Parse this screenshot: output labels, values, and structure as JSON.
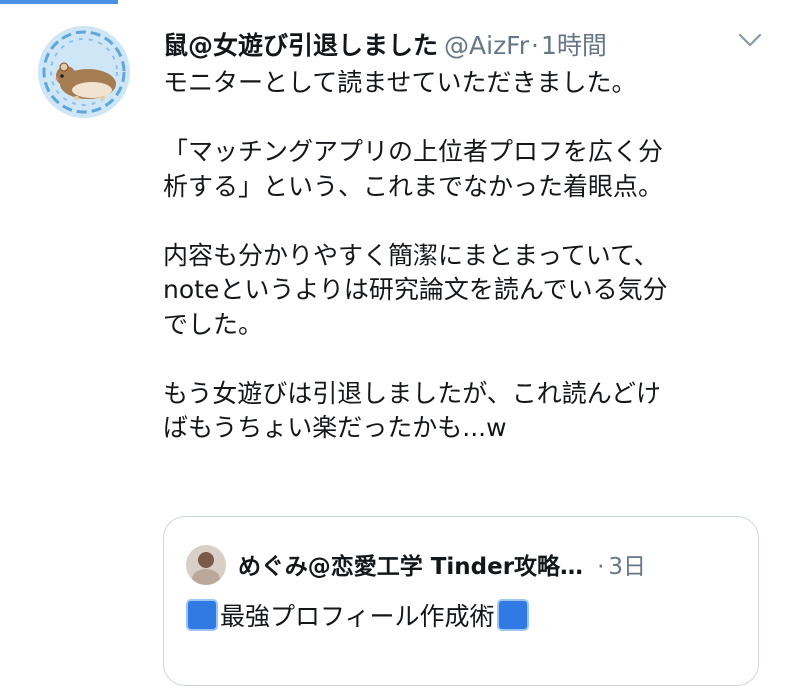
{
  "tweet": {
    "display_name": "鼠@女遊び引退しました",
    "handle": "@AizFr",
    "separator": "·",
    "time": "1時間",
    "paragraphs": [
      [
        "モニターとして読ませていただきました。"
      ],
      [
        "「マッチングアプリの上位者プロフを広く分",
        "析する」という、これまでなかった着眼点。"
      ],
      [
        "内容も分かりやすく簡潔にまとまっていて、",
        "noteというよりは研究論文を読んでいる気分",
        "でした。"
      ],
      [
        "もう女遊びは引退しましたが、これ読んどけ",
        "ばもうちょい楽だったかも...w"
      ]
    ]
  },
  "quote": {
    "display_name": "めぐみ@恋愛工学 Tinder攻略…",
    "separator": "·",
    "time": "3日",
    "text": "最強プロフィール作成術",
    "emoji_icon": "blue-square-emoji",
    "emoji_color": "#2f7be3"
  },
  "colors": {
    "text": "#14171a",
    "secondary": "#657786",
    "border": "#ccd6dd",
    "accent": "#4a90e2"
  },
  "icons": {
    "menu": "chevron-down-icon",
    "avatar": "hamster-avatar"
  }
}
